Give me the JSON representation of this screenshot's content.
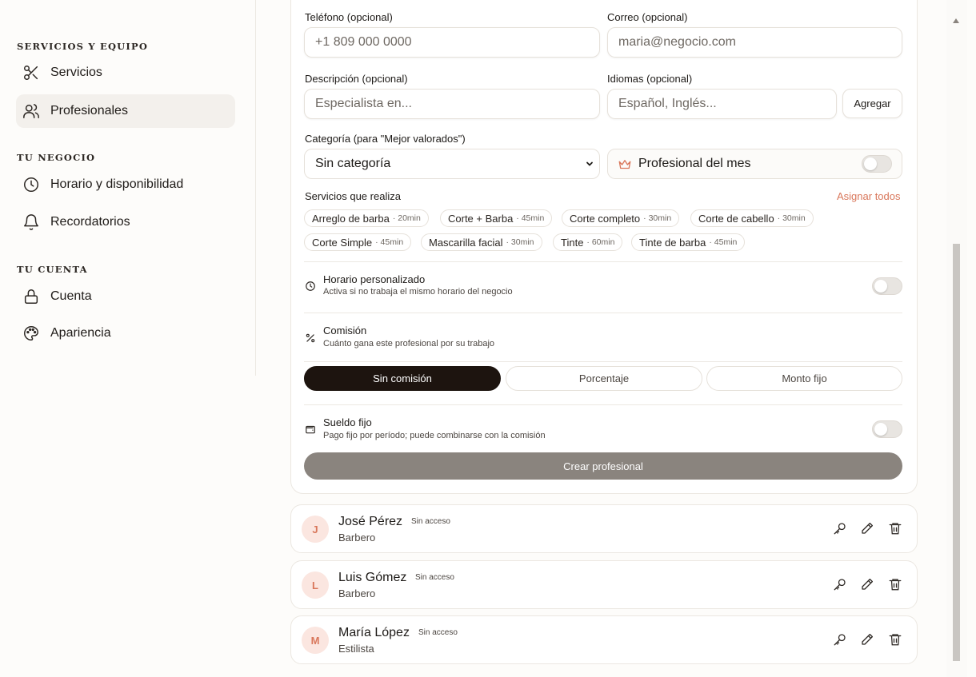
{
  "sidebar": {
    "sections": [
      {
        "title": "SERVICIOS Y EQUIPO",
        "items": [
          {
            "label": "Servicios",
            "icon": "scissors-icon"
          },
          {
            "label": "Profesionales",
            "icon": "users-icon"
          }
        ]
      },
      {
        "title": "TU NEGOCIO",
        "items": [
          {
            "label": "Horario y disponibilidad",
            "icon": "clock-icon"
          },
          {
            "label": "Recordatorios",
            "icon": "bell-icon"
          }
        ]
      },
      {
        "title": "TU CUENTA",
        "items": [
          {
            "label": "Cuenta",
            "icon": "lock-icon"
          },
          {
            "label": "Apariencia",
            "icon": "palette-icon"
          }
        ]
      }
    ],
    "active_item": "Profesionales"
  },
  "form": {
    "phone_label": "Teléfono (opcional)",
    "phone_placeholder": "+1 809 000 0000",
    "email_label": "Correo (opcional)",
    "email_placeholder": "maria@negocio.com",
    "description_label": "Descripción (opcional)",
    "description_placeholder": "Especialista en...",
    "languages_label": "Idiomas (opcional)",
    "languages_placeholder": "Español, Inglés...",
    "add_button": "Agregar",
    "category_label": "Categoría (para \"Mejor valorados\")",
    "category_value": "Sin categoría",
    "pro_of_month_label": "Profesional del mes",
    "pro_of_month_on": false,
    "services_label": "Servicios que realiza",
    "assign_all": "Asignar todos",
    "services": [
      {
        "name": "Arreglo de barba",
        "dur": "· 20min"
      },
      {
        "name": "Corte + Barba",
        "dur": "· 45min"
      },
      {
        "name": "Corte completo",
        "dur": "· 30min"
      },
      {
        "name": "Corte de cabello",
        "dur": "· 30min"
      },
      {
        "name": "Corte Simple",
        "dur": "· 45min"
      },
      {
        "name": "Mascarilla facial",
        "dur": "· 30min"
      },
      {
        "name": "Tinte",
        "dur": "· 60min"
      },
      {
        "name": "Tinte de barba",
        "dur": "· 45min"
      }
    ],
    "custom_schedule": {
      "title": "Horario personalizado",
      "subtitle": "Activa si no trabaja el mismo horario del negocio",
      "on": false
    },
    "commission": {
      "title": "Comisión",
      "subtitle": "Cuánto gana este profesional por su trabajo",
      "options": [
        "Sin comisión",
        "Porcentaje",
        "Monto fijo"
      ],
      "selected": "Sin comisión"
    },
    "salary": {
      "title": "Sueldo fijo",
      "subtitle": "Pago fijo por período; puede combinarse con la comisión",
      "on": false
    },
    "create_button": "Crear profesional"
  },
  "professionals": [
    {
      "initial": "J",
      "name": "José Pérez",
      "badge": "Sin acceso",
      "role": "Barbero"
    },
    {
      "initial": "L",
      "name": "Luis Gómez",
      "badge": "Sin acceso",
      "role": "Barbero"
    },
    {
      "initial": "M",
      "name": "María López",
      "badge": "Sin acceso",
      "role": "Estilista"
    }
  ],
  "colors": {
    "accent": "#d9775b",
    "primary_dark": "#1d140f",
    "disabled_button": "#8a847e"
  }
}
